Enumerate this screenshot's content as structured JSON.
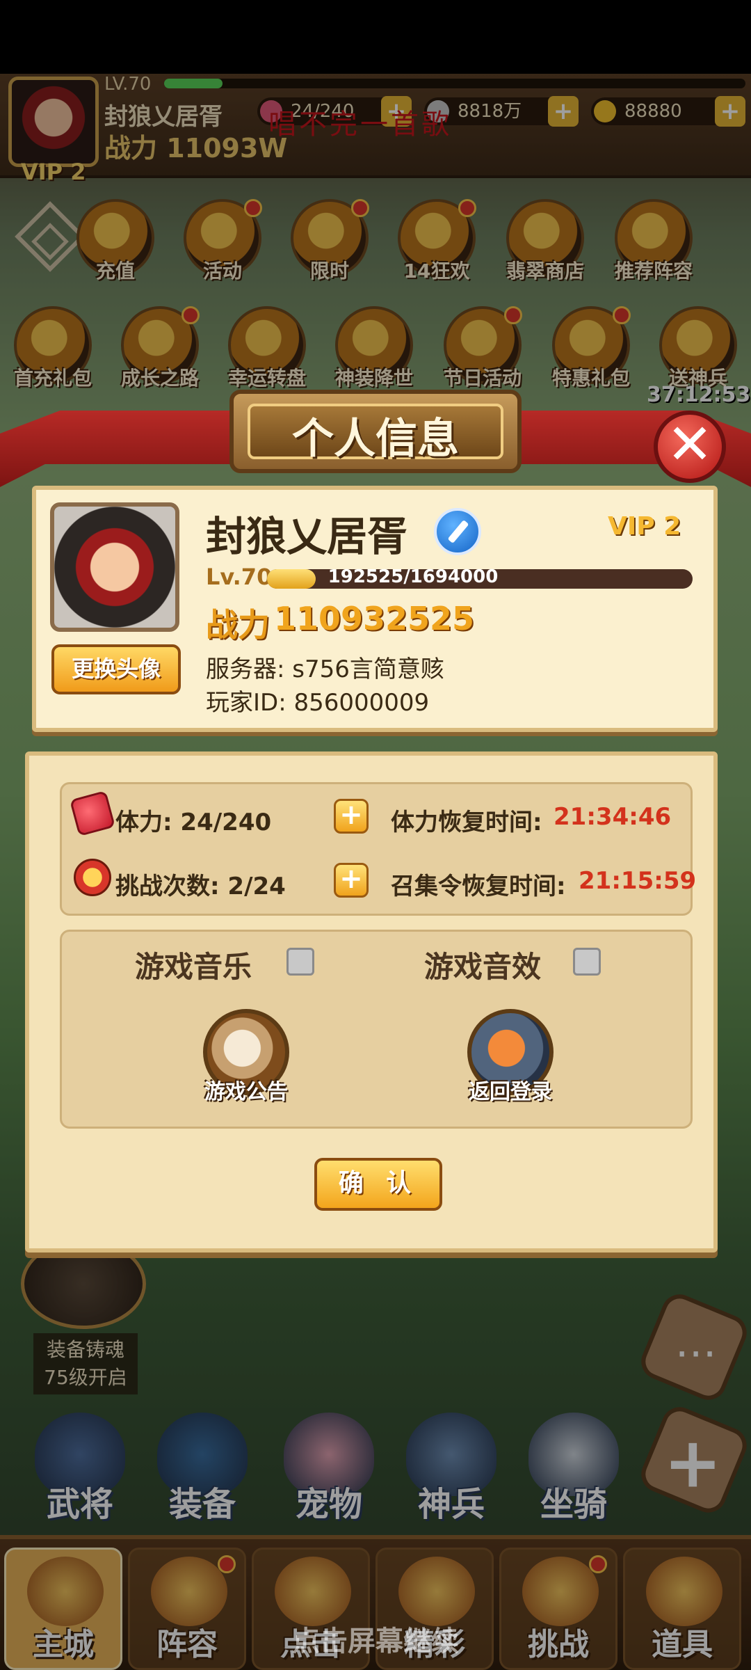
{
  "top_bar": {
    "level": "LV.70",
    "name": "封狼乂居胥",
    "power": "战力 11093W",
    "vip": "VIP 2",
    "stamina": "24/240",
    "silver": "8818万",
    "gold": "88880",
    "plus": "+",
    "record_overlay": "唱不完一首歌"
  },
  "menu": {
    "row1": [
      "充值",
      "活动",
      "限时",
      "14狂欢",
      "翡翠商店",
      "推荐阵容"
    ],
    "row2": [
      "首充礼包",
      "成长之路",
      "幸运转盘",
      "神装降世",
      "节日活动",
      "特惠礼包",
      "送神兵"
    ],
    "countdown": "37:12:53"
  },
  "modal": {
    "title": "个人信息",
    "close": "✕",
    "player_name": "封狼乂居胥",
    "vip": "VIP 2",
    "level": "Lv.70",
    "exp": "192525/1694000",
    "exp_fraction": 0.114,
    "power_label": "战力",
    "power_value": "110932525",
    "server": "服务器:  s756言简意赅",
    "player_id": "玩家ID:  856000009",
    "change_avatar": "更换头像",
    "stamina_label": "体力:  24/240",
    "stamina_recover_label": "体力恢复时间:",
    "stamina_recover_time": "21:34:46",
    "challenge_label": "挑战次数:  2/24",
    "rally_recover_label": "召集令恢复时间:",
    "rally_recover_time": "21:15:59",
    "plus": "+",
    "music_label": "游戏音乐",
    "sound_label": "游戏音效",
    "announcement": "游戏公告",
    "return_login": "返回登录",
    "confirm": "确 认"
  },
  "scene": {
    "forge_label_1": "装备铸魂",
    "forge_label_2": "75级开启",
    "features": [
      "武将",
      "装备",
      "宠物",
      "神兵",
      "坐骑"
    ]
  },
  "bottom_nav": {
    "tabs": [
      "主城",
      "阵容",
      "点击",
      "精彩",
      "挑战",
      "道具"
    ],
    "tap_hint": "点击屏幕继续"
  },
  "colors": {
    "accent_gold": "#f0a41d",
    "timer_red": "#d3321c",
    "close_red": "#b21412",
    "modal_paper": "#fbf0cf"
  }
}
